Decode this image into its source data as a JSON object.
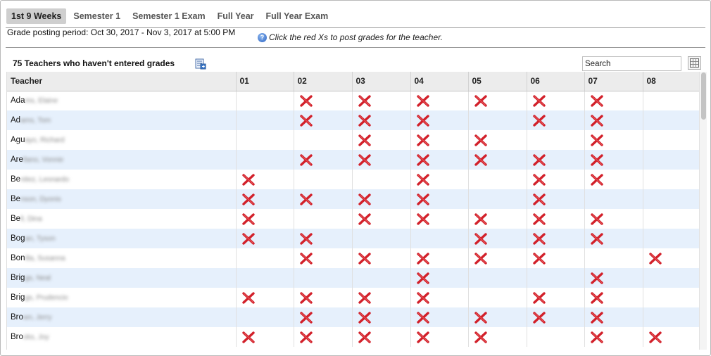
{
  "tabs": [
    {
      "label": "1st 9 Weeks",
      "active": true
    },
    {
      "label": "Semester 1",
      "active": false
    },
    {
      "label": "Semester 1 Exam",
      "active": false
    },
    {
      "label": "Full Year",
      "active": false
    },
    {
      "label": "Full Year Exam",
      "active": false
    }
  ],
  "period_text": "Grade posting period: Oct 30, 2017 - Nov 3, 2017 at 5:00 PM",
  "hint_text": "Click the red Xs to post grades for the teacher.",
  "count_title": "75 Teachers who haven't entered grades",
  "search": {
    "placeholder": "Search"
  },
  "colors": {
    "accent_x": "#d2202a",
    "row_alt": "#e6f0fc",
    "header_bg": "#ececec",
    "tab_active": "#cfcfcf"
  },
  "table": {
    "headers": [
      "Teacher",
      "01",
      "02",
      "03",
      "04",
      "05",
      "06",
      "07",
      "08"
    ],
    "rows": [
      {
        "prefix": "Ada",
        "hidden": "ms, Elaine",
        "marks": [
          0,
          1,
          1,
          1,
          1,
          1,
          1,
          0
        ]
      },
      {
        "prefix": "Ad",
        "hidden": "ams, Tom",
        "marks": [
          0,
          1,
          1,
          1,
          0,
          1,
          1,
          0
        ]
      },
      {
        "prefix": "Agu",
        "hidden": "ayo, Richard",
        "marks": [
          0,
          0,
          1,
          1,
          1,
          0,
          1,
          0
        ]
      },
      {
        "prefix": "Are",
        "hidden": "llano, Vonnie",
        "marks": [
          0,
          1,
          1,
          1,
          1,
          1,
          1,
          0
        ]
      },
      {
        "prefix": "Be",
        "hidden": "nitez, Leonardo",
        "marks": [
          1,
          0,
          0,
          1,
          0,
          1,
          1,
          0
        ]
      },
      {
        "prefix": "Be",
        "hidden": "nson, Dyonis",
        "marks": [
          1,
          1,
          1,
          1,
          0,
          1,
          0,
          0
        ]
      },
      {
        "prefix": "Be",
        "hidden": "ll, Dina",
        "marks": [
          1,
          0,
          1,
          1,
          1,
          1,
          1,
          0
        ]
      },
      {
        "prefix": "Bog",
        "hidden": "an, Tyson",
        "marks": [
          1,
          1,
          0,
          0,
          1,
          1,
          1,
          0
        ]
      },
      {
        "prefix": "Bon",
        "hidden": "illa, Susanna",
        "marks": [
          0,
          1,
          1,
          1,
          1,
          1,
          0,
          1
        ]
      },
      {
        "prefix": "Brig",
        "hidden": "gs, Neal",
        "marks": [
          0,
          0,
          0,
          1,
          0,
          0,
          1,
          0
        ]
      },
      {
        "prefix": "Brig",
        "hidden": "gs, Prudencio",
        "marks": [
          1,
          1,
          1,
          1,
          0,
          1,
          1,
          0
        ]
      },
      {
        "prefix": "Bro",
        "hidden": "wn, Jerry",
        "marks": [
          0,
          1,
          1,
          1,
          1,
          1,
          1,
          0
        ]
      },
      {
        "prefix": "Bro",
        "hidden": "oks, Joy",
        "marks": [
          1,
          1,
          1,
          1,
          1,
          0,
          1,
          1
        ]
      }
    ]
  }
}
